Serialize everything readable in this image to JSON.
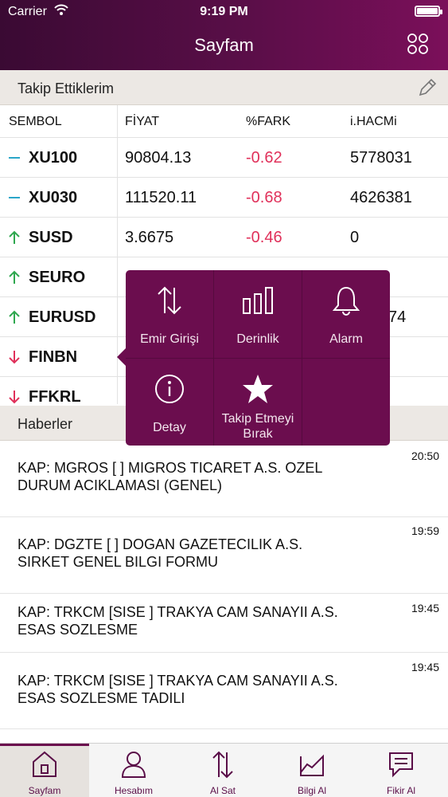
{
  "status_bar": {
    "carrier": "Carrier",
    "time": "9:19 PM"
  },
  "header": {
    "title": "Sayfam"
  },
  "watchlist": {
    "title": "Takip Ettiklerim",
    "columns": [
      "SEMBOL",
      "FİYAT",
      "%FARK",
      "i.HACMi"
    ],
    "rows": [
      {
        "symbol": "XU100",
        "trend": "flat",
        "price": "90804.13",
        "diff": "-0.62",
        "volume": "5778031"
      },
      {
        "symbol": "XU030",
        "trend": "flat",
        "price": "111520.11",
        "diff": "-0.68",
        "volume": "4626381"
      },
      {
        "symbol": "SUSD",
        "trend": "up",
        "price": "3.6675",
        "diff": "-0.46",
        "volume": "0"
      },
      {
        "symbol": "SEURO",
        "trend": "up",
        "price": "",
        "diff": "",
        "volume": ""
      },
      {
        "symbol": "EURUSD",
        "trend": "up",
        "price": "",
        "diff": "",
        "volume": "74"
      },
      {
        "symbol": "FINBN",
        "trend": "down",
        "price": "",
        "diff": "",
        "volume": ""
      },
      {
        "symbol": "FFKRL",
        "trend": "down",
        "price": "",
        "diff": "",
        "volume": ""
      }
    ]
  },
  "popup": {
    "items": [
      {
        "label": "Emir Girişi",
        "icon": "order-entry-icon"
      },
      {
        "label": "Derinlik",
        "icon": "depth-bars-icon"
      },
      {
        "label": "Alarm",
        "icon": "bell-icon"
      },
      {
        "label": "Detay",
        "icon": "info-icon"
      },
      {
        "label": "Takip Etmeyi Bırak",
        "label_line1": "Takip Etmeyi",
        "label_line2": "Bırak",
        "icon": "star-icon"
      }
    ]
  },
  "news": {
    "title": "Haberler",
    "items": [
      {
        "time": "20:50",
        "line1": "KAP: MGROS  [ ] MIGROS TICARET A.S.  OZEL",
        "line2": "DURUM ACIKLAMASI (GENEL)"
      },
      {
        "time": "19:59",
        "line1": "KAP: DGZTE  [ ] DOGAN GAZETECILIK A.S.",
        "line2": "SIRKET GENEL BILGI FORMU"
      },
      {
        "time": "19:45",
        "line1": "KAP: TRKCM  [SISE ] TRAKYA CAM SANAYII A.S.",
        "line2": "ESAS SOZLESME"
      },
      {
        "time": "19:45",
        "line1": "KAP: TRKCM  [SISE ] TRAKYA CAM SANAYII A.S.",
        "line2": "ESAS SOZLESME TADILI"
      }
    ]
  },
  "tabbar": {
    "tabs": [
      {
        "label": "Sayfam",
        "icon": "home-icon",
        "active": true
      },
      {
        "label": "Hesabım",
        "icon": "user-icon",
        "active": false
      },
      {
        "label": "Al Sat",
        "icon": "buy-sell-icon",
        "active": false
      },
      {
        "label": "Bilgi Al",
        "icon": "chart-icon",
        "active": false
      },
      {
        "label": "Fikir Al",
        "icon": "message-icon",
        "active": false
      }
    ]
  },
  "colors": {
    "brand": "#6b0d4e",
    "negative": "#e0305a",
    "flat": "#2aa6c9",
    "up": "#2fa84f",
    "down": "#e0305a"
  }
}
